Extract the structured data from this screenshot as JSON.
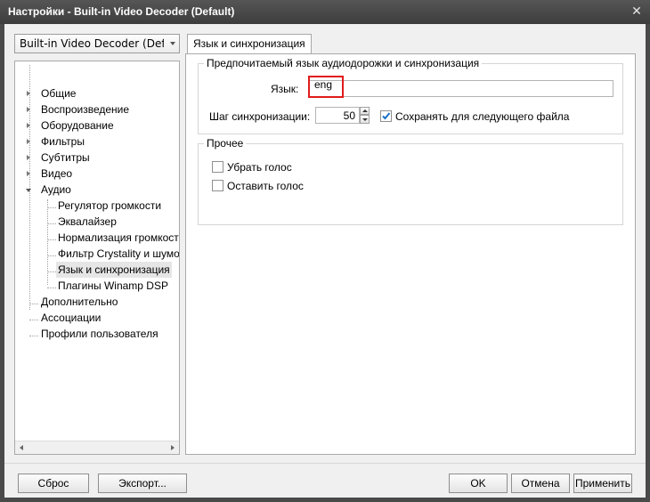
{
  "window": {
    "title": "Настройки - Built-in Video Decoder (Default)",
    "close_glyph": "✕"
  },
  "sidebar": {
    "dropdown_value": "Built-in Video Decoder (Default",
    "tree": [
      {
        "label": "Общие"
      },
      {
        "label": "Воспроизведение"
      },
      {
        "label": "Оборудование"
      },
      {
        "label": "Фильтры"
      },
      {
        "label": "Субтитры"
      },
      {
        "label": "Видео"
      },
      {
        "label": "Аудио"
      },
      {
        "label": "Регулятор громкости"
      },
      {
        "label": "Эквалайзер"
      },
      {
        "label": "Нормализация громкости"
      },
      {
        "label": "Фильтр Crystality и шумоподавление"
      },
      {
        "label": "Язык и синхронизация",
        "selected": true
      },
      {
        "label": "Плагины Winamp DSP"
      },
      {
        "label": "Дополнительно"
      },
      {
        "label": "Ассоциации"
      },
      {
        "label": "Профили пользователя"
      }
    ]
  },
  "tab": {
    "label": "Язык и синхронизация"
  },
  "group_lang": {
    "title": "Предпочитаемый язык аудиодорожки и синхронизация",
    "language_label": "Язык:",
    "language_value": "eng",
    "sync_label": "Шаг синхронизации:",
    "sync_value": "50",
    "remember_label": "Сохранять для следующего файла",
    "remember_checked": true
  },
  "group_other": {
    "title": "Прочее",
    "remove_voice_label": "Убрать голос",
    "keep_voice_label": "Оставить голос"
  },
  "buttons": {
    "reset": "Сброс",
    "export": "Экспорт...",
    "ok": "OK",
    "cancel": "Отмена",
    "apply": "Применить"
  },
  "colors": {
    "highlight": "#e01b1b",
    "check": "#1b6fc6",
    "titlebar": "#444444"
  }
}
